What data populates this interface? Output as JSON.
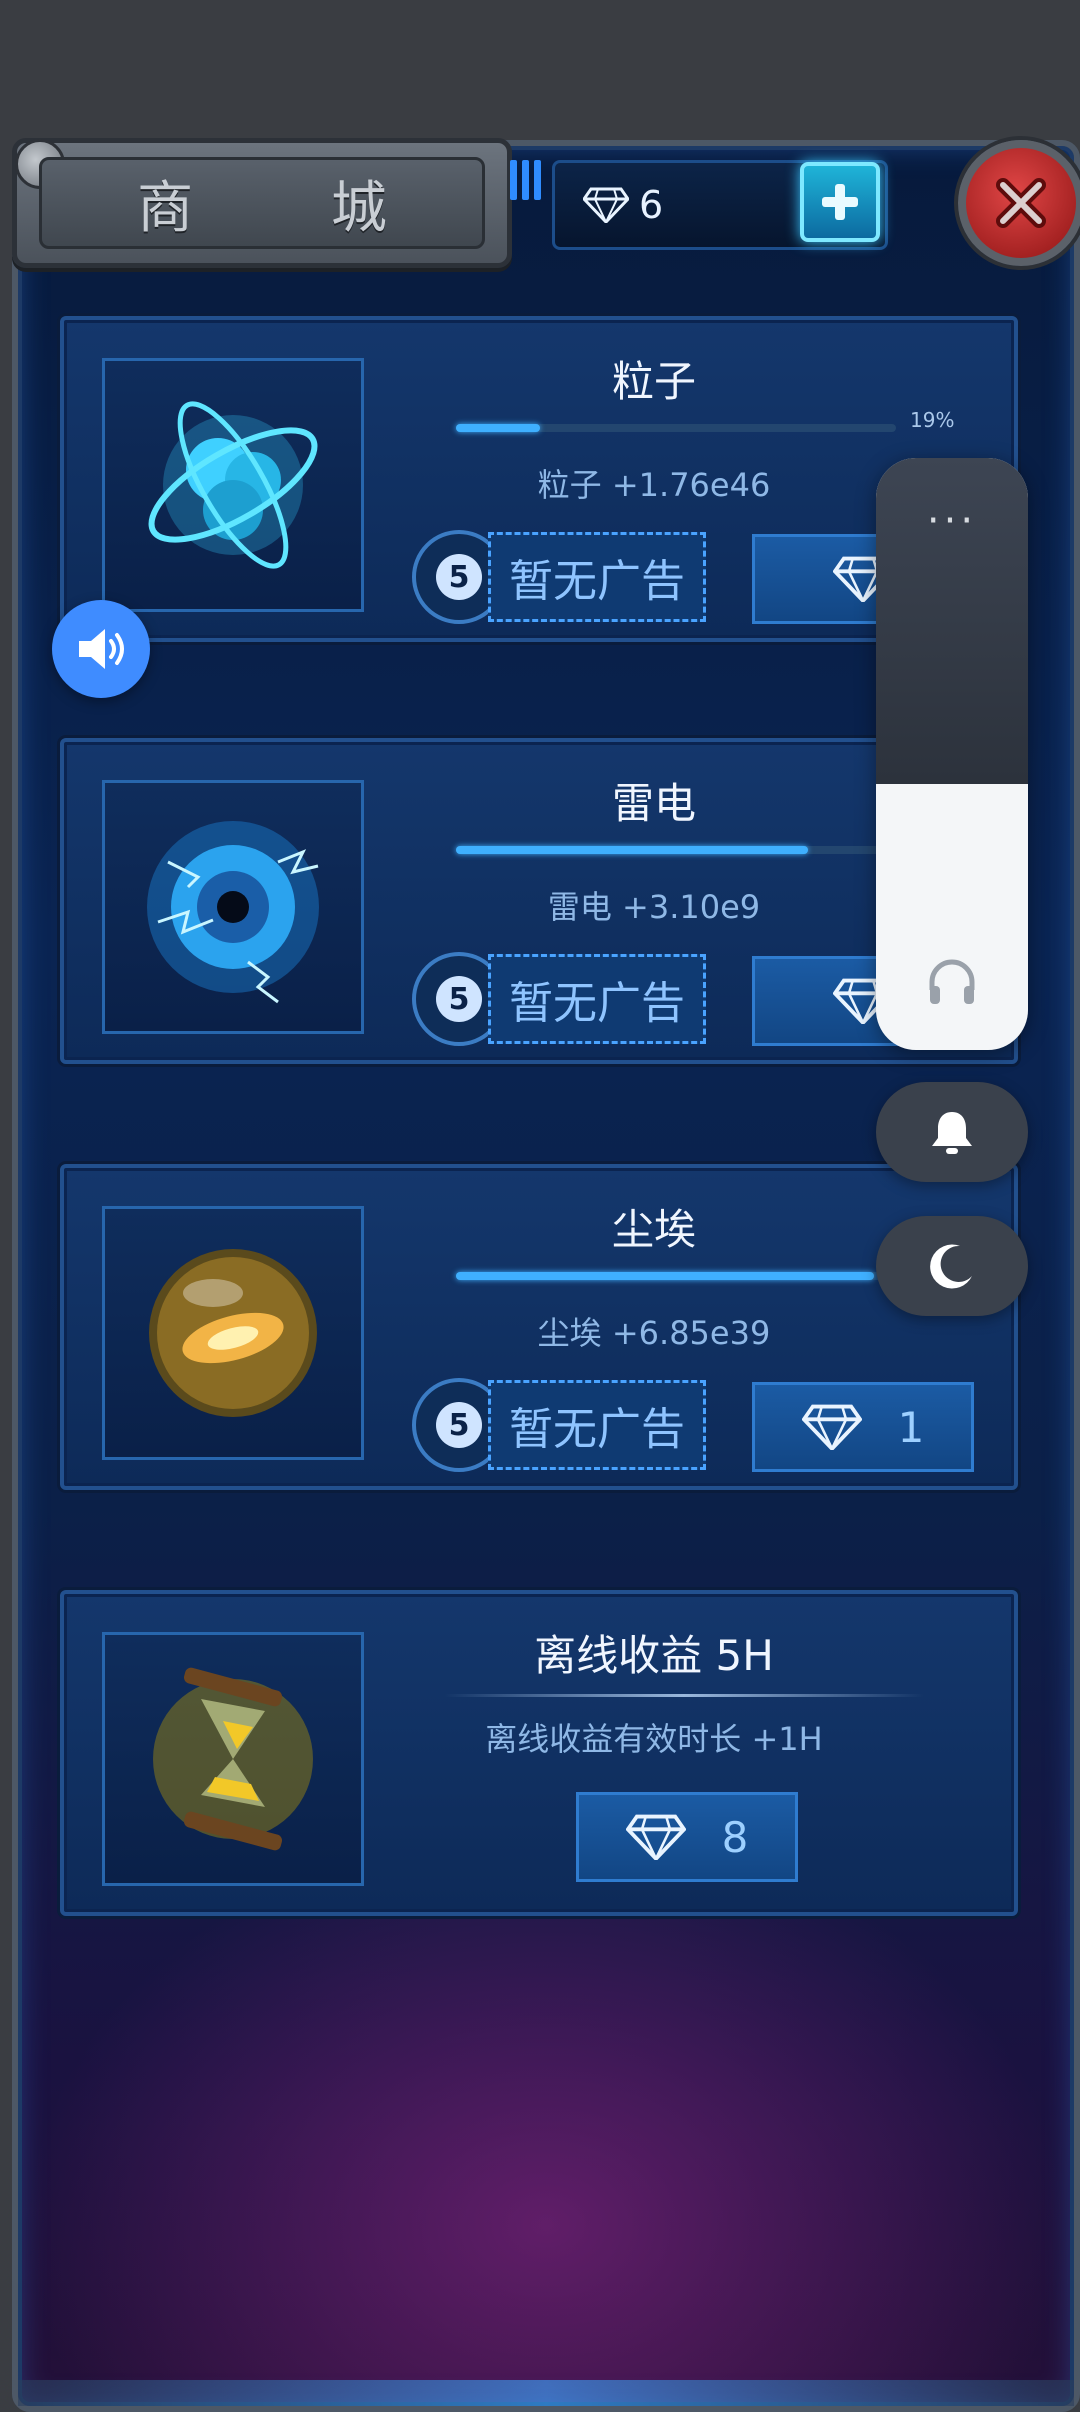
{
  "header": {
    "title": "商 城",
    "gem_count": "6"
  },
  "items": [
    {
      "title": "粒子",
      "progress_percent": 19,
      "progress_label": "19%",
      "desc": "粒子  +1.76e46",
      "ad_count": "5",
      "ad_label": "暂无广告",
      "icon": "particle-icon"
    },
    {
      "title": "雷电",
      "progress_percent": 80,
      "desc": "雷电  +3.10e9",
      "ad_count": "5",
      "ad_label": "暂无广告",
      "icon": "thunder-orb-icon"
    },
    {
      "title": "尘埃",
      "progress_percent": 95,
      "desc": "尘埃  +6.85e39",
      "ad_count": "5",
      "ad_label": "暂无广告",
      "gem_price": "1",
      "icon": "dust-orb-icon"
    },
    {
      "title": "离线收益 5H",
      "desc": "离线收益有效时长  +1H",
      "gem_price": "8",
      "icon": "hourglass-icon"
    }
  ],
  "system_overlay": {
    "more_label": "···",
    "volume_level_percent": 45
  },
  "colors": {
    "accent": "#3fb0ff",
    "gem": "#e9f4ff",
    "close": "#c92a2a"
  }
}
